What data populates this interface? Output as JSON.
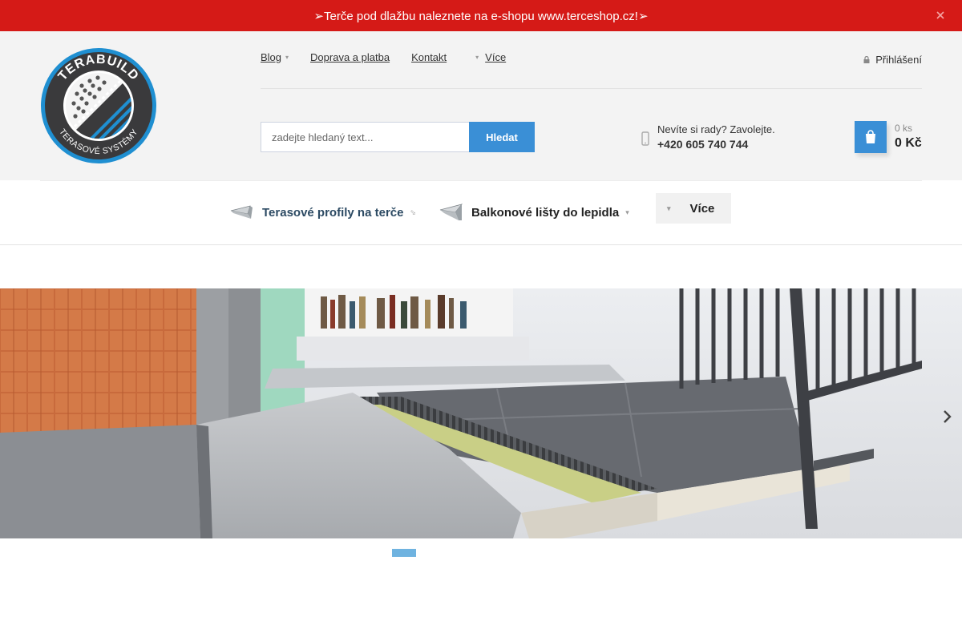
{
  "announcement": {
    "text": "➢Terče pod dlažbu naleznete na e-shopu www.terceshop.cz!➢",
    "close_icon": "close-icon",
    "bg_color": "#d51a17"
  },
  "logo": {
    "arc_top": "TERABUILD",
    "arc_bottom": "TERASOVÉ SYSTÉMY"
  },
  "top_nav": {
    "items": [
      {
        "label": "Blog",
        "has_submenu": true
      },
      {
        "label": "Doprava a platba"
      },
      {
        "label": "Kontakt"
      },
      {
        "label": "Více",
        "has_submenu": true
      }
    ]
  },
  "login": {
    "label": "Přihlášení",
    "icon": "lock-icon"
  },
  "search": {
    "placeholder": "zadejte hledaný text...",
    "value": "",
    "button_label": "Hledat",
    "accent": "#3a8fd6"
  },
  "contact": {
    "question": "Nevíte si rady? Zavolejte.",
    "phone": "+420 605 740 744",
    "icon": "phone-icon"
  },
  "cart": {
    "quantity": "0 ks",
    "total": "0 Kč",
    "icon": "cart-icon"
  },
  "main_nav": {
    "items": [
      {
        "label": "Terasové profily na terče",
        "icon": "profile-icon",
        "active": true
      },
      {
        "label": "Balkonové lišty do lepidla",
        "icon": "profile-icon",
        "active": false
      }
    ],
    "more_label": "Více"
  },
  "slider": {
    "slide_count": 1,
    "active_slide": 1,
    "next_icon": "chevron-right-icon",
    "dot_color": "#6fb3e0"
  }
}
